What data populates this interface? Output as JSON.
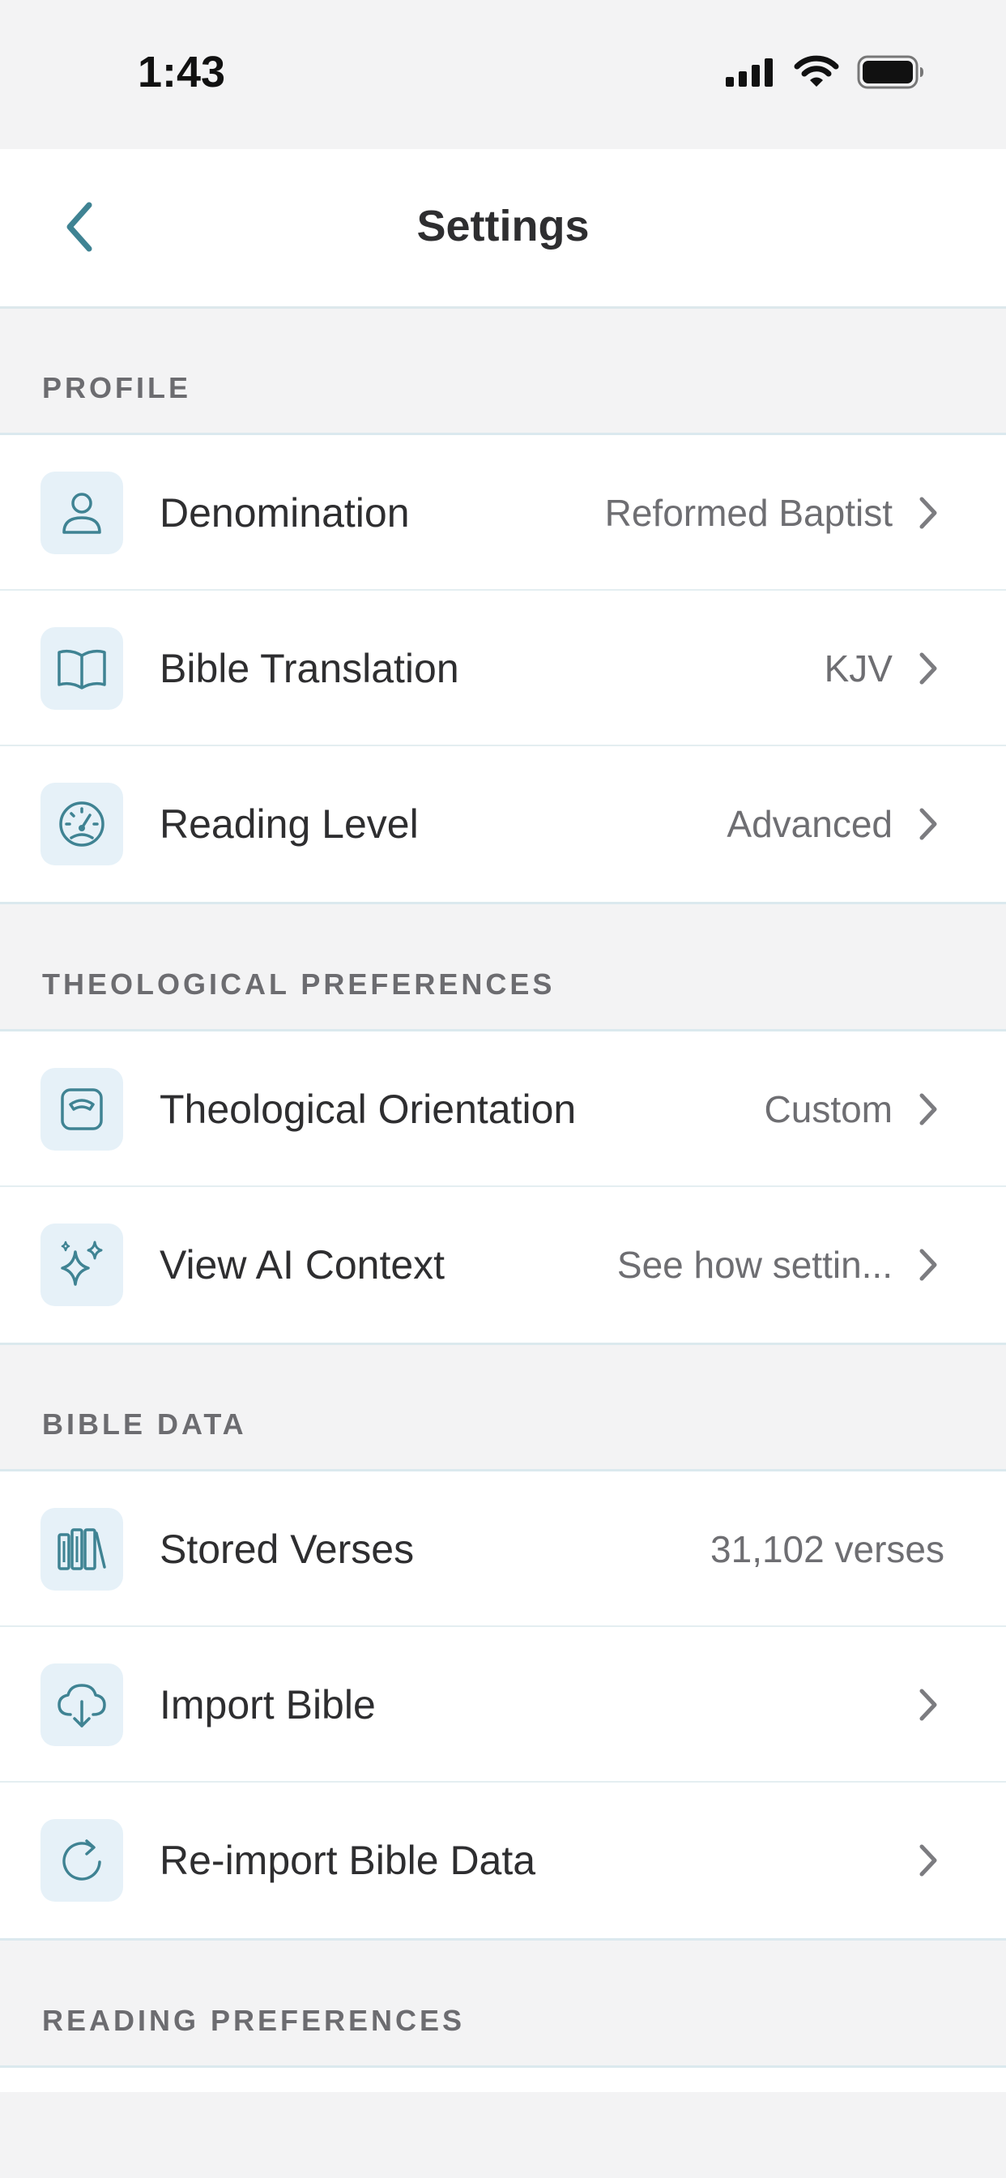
{
  "status_bar": {
    "time": "1:43"
  },
  "nav": {
    "title": "Settings"
  },
  "sections": {
    "profile": {
      "header": "PROFILE",
      "rows": [
        {
          "label": "Denomination",
          "value": "Reformed Baptist",
          "icon": "person-icon"
        },
        {
          "label": "Bible Translation",
          "value": "KJV",
          "icon": "book-icon"
        },
        {
          "label": "Reading Level",
          "value": "Advanced",
          "icon": "gauge-icon"
        }
      ]
    },
    "theological": {
      "header": "THEOLOGICAL PREFERENCES",
      "rows": [
        {
          "label": "Theological Orientation",
          "value": "Custom",
          "icon": "scale-icon"
        },
        {
          "label": "View AI Context",
          "value": "See how settin...",
          "icon": "sparkles-icon"
        }
      ]
    },
    "bible_data": {
      "header": "BIBLE DATA",
      "rows": [
        {
          "label": "Stored Verses",
          "value": "31,102 verses",
          "icon": "books-icon"
        },
        {
          "label": "Import Bible",
          "value": "",
          "icon": "cloud-download-icon"
        },
        {
          "label": "Re-import Bible Data",
          "value": "",
          "icon": "refresh-icon"
        }
      ]
    },
    "reading": {
      "header": "READING PREFERENCES"
    }
  },
  "colors": {
    "accent": "#3f8393",
    "icon_bg": "#e6f1f8",
    "background": "#f3f3f4",
    "divider": "#dbe9ee"
  }
}
